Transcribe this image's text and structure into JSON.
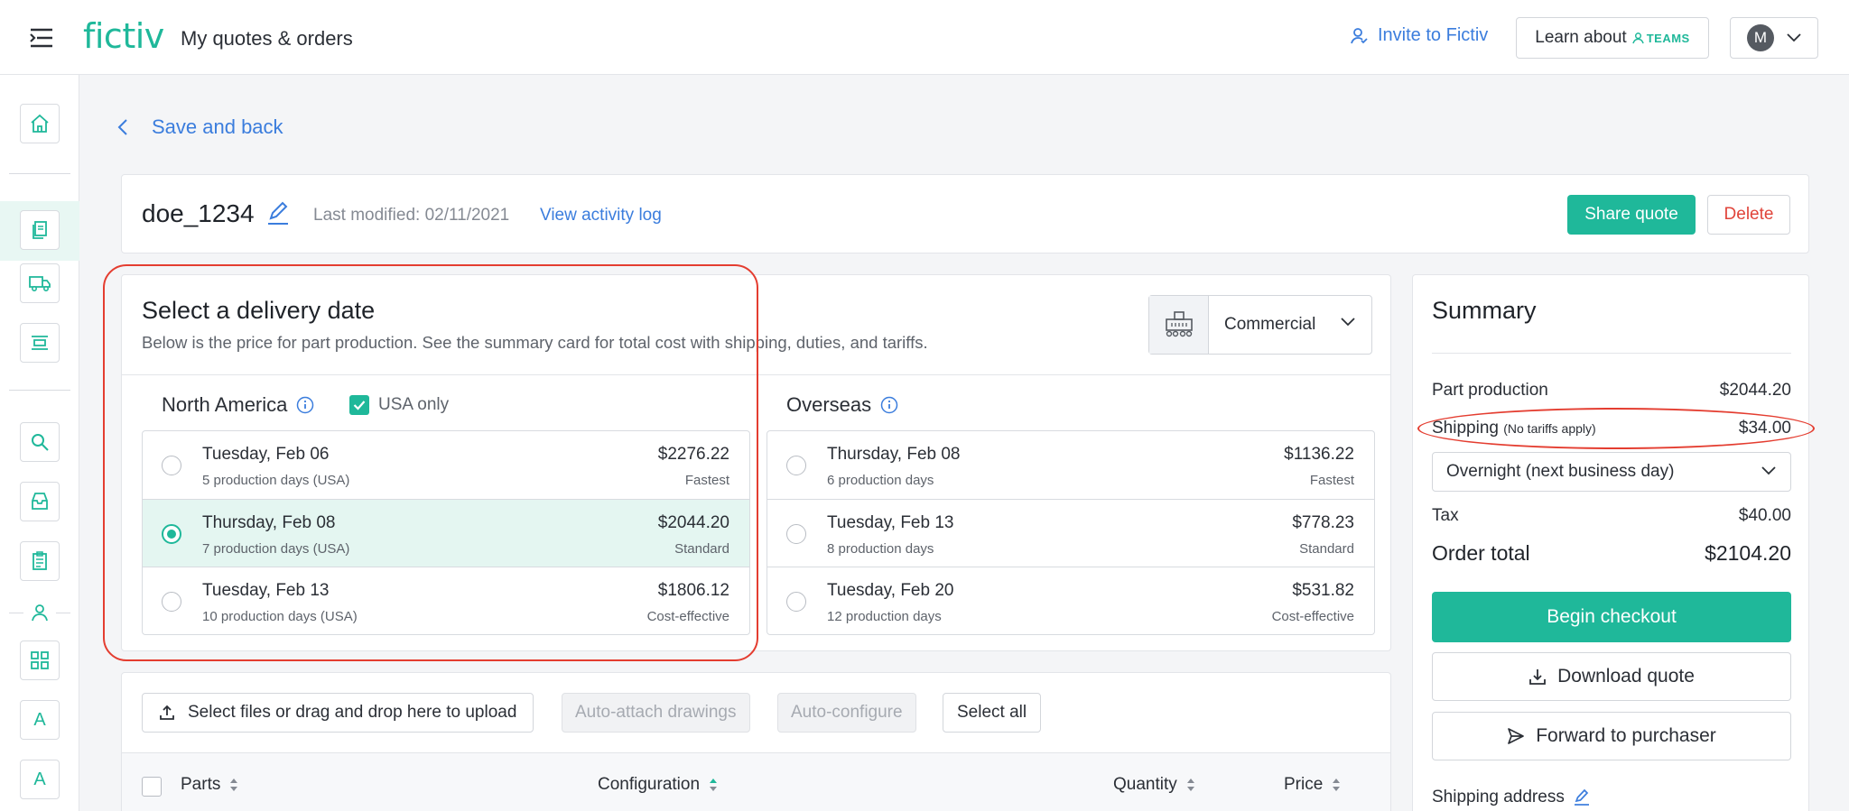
{
  "header": {
    "logo": "fictiv",
    "page_title": "My quotes & orders",
    "invite_label": "Invite to Fictiv",
    "learn_label": "Learn about",
    "teams_label": "TEAMS",
    "avatar_initial": "M"
  },
  "back_label": "Save and back",
  "quote": {
    "name": "doe_1234",
    "last_modified": "Last modified: 02/11/2021",
    "activity_link": "View activity log",
    "share_label": "Share quote",
    "delete_label": "Delete"
  },
  "delivery": {
    "title": "Select a delivery date",
    "subtitle": "Below is the price for part production. See the summary card for total cost with shipping, duties, and tariffs.",
    "shipping_type": "Commercial",
    "north_america": {
      "title": "North America",
      "usa_only_label": "USA only",
      "usa_only_checked": true,
      "options": [
        {
          "date": "Tuesday, Feb 06",
          "days": "5 production days (USA)",
          "price": "$2276.22",
          "tag": "Fastest",
          "selected": false
        },
        {
          "date": "Thursday, Feb 08",
          "days": "7 production days (USA)",
          "price": "$2044.20",
          "tag": "Standard",
          "selected": true
        },
        {
          "date": "Tuesday, Feb 13",
          "days": "10 production days (USA)",
          "price": "$1806.12",
          "tag": "Cost-effective",
          "selected": false
        }
      ]
    },
    "overseas": {
      "title": "Overseas",
      "options": [
        {
          "date": "Thursday, Feb 08",
          "days": "6 production days",
          "price": "$1136.22",
          "tag": "Fastest",
          "selected": false
        },
        {
          "date": "Tuesday, Feb 13",
          "days": "8 production days",
          "price": "$778.23",
          "tag": "Standard",
          "selected": false
        },
        {
          "date": "Tuesday, Feb 20",
          "days": "12 production days",
          "price": "$531.82",
          "tag": "Cost-effective",
          "selected": false
        }
      ]
    }
  },
  "parts": {
    "upload_label": "Select files or drag and drop here to upload",
    "auto_attach_label": "Auto-attach drawings",
    "auto_configure_label": "Auto-configure",
    "select_all_label": "Select all",
    "columns": [
      "Parts",
      "Configuration",
      "Quantity",
      "Price"
    ]
  },
  "summary": {
    "title": "Summary",
    "part_production_label": "Part production",
    "part_production_value": "$2044.20",
    "shipping_label": "Shipping",
    "shipping_note": "(No tariffs apply)",
    "shipping_value": "$34.00",
    "shipping_method": "Overnight (next business day)",
    "tax_label": "Tax",
    "tax_value": "$40.00",
    "total_label": "Order total",
    "total_value": "$2104.20",
    "checkout_label": "Begin checkout",
    "download_label": "Download quote",
    "forward_label": "Forward to purchaser",
    "shipping_address_label": "Shipping address"
  },
  "sidebar_icons": [
    "home-icon",
    "quotes-icon",
    "truck-icon",
    "tray-icon",
    "search-icon",
    "inbox-icon",
    "clipboard-icon",
    "team-icon",
    "grid-icon",
    "letter-a-icon",
    "letter-a-icon"
  ],
  "sidebar_letter": "A",
  "colors": {
    "accent": "#1fb89a",
    "link": "#3b7ddd",
    "danger": "#e0443a",
    "annotation": "#e43d30"
  }
}
